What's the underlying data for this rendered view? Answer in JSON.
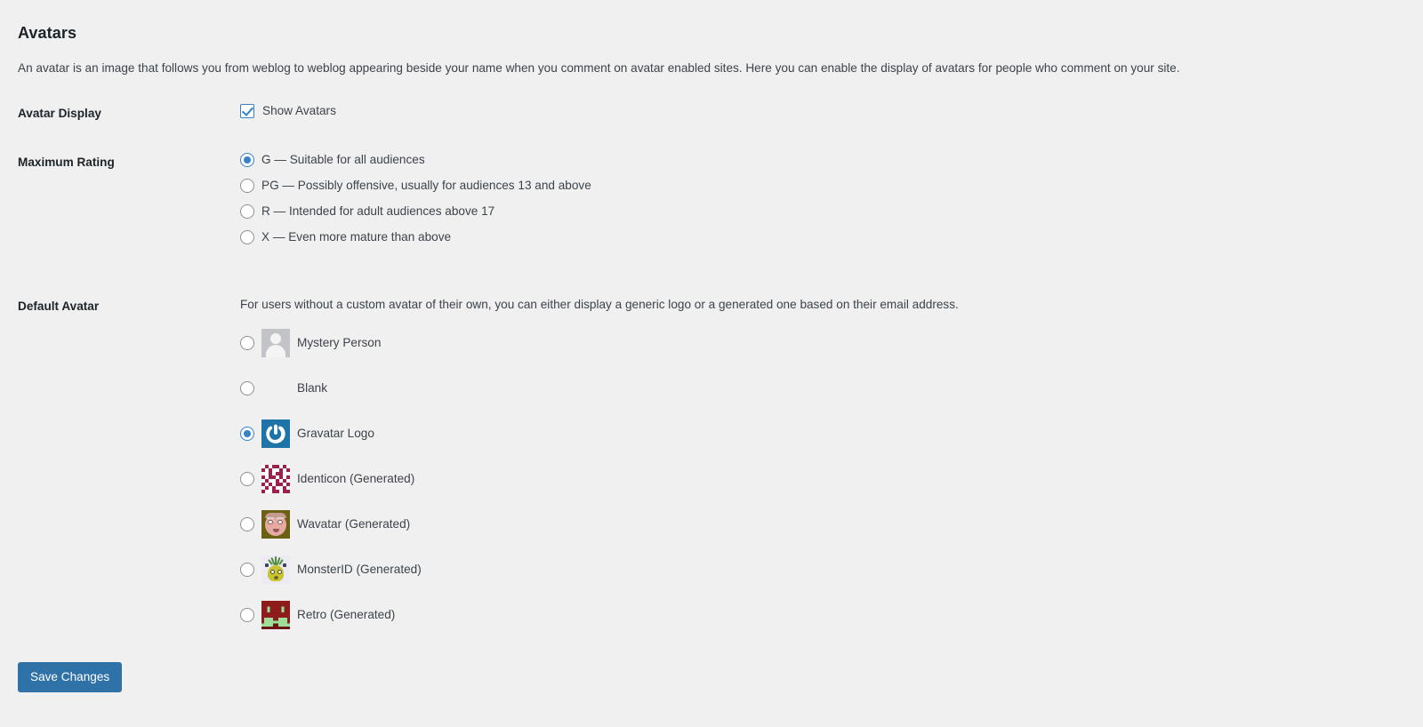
{
  "section": {
    "title": "Avatars",
    "description": "An avatar is an image that follows you from weblog to weblog appearing beside your name when you comment on avatar enabled sites. Here you can enable the display of avatars for people who comment on your site."
  },
  "avatar_display": {
    "label": "Avatar Display",
    "checkbox_label": "Show Avatars",
    "checked": true
  },
  "maximum_rating": {
    "label": "Maximum Rating",
    "selected": "G",
    "options": [
      {
        "value": "G",
        "label": "G — Suitable for all audiences",
        "checked": true
      },
      {
        "value": "PG",
        "label": "PG — Possibly offensive, usually for audiences 13 and above",
        "checked": false
      },
      {
        "value": "R",
        "label": "R — Intended for adult audiences above 17",
        "checked": false
      },
      {
        "value": "X",
        "label": "X — Even more mature than above",
        "checked": false
      }
    ]
  },
  "default_avatar": {
    "label": "Default Avatar",
    "description": "For users without a custom avatar of their own, you can either display a generic logo or a generated one based on their email address.",
    "selected": "gravatar_default",
    "options": [
      {
        "value": "mystery",
        "label": "Mystery Person",
        "icon": "mystery-person-avatar",
        "checked": false
      },
      {
        "value": "blank",
        "label": "Blank",
        "icon": "blank-avatar",
        "checked": false
      },
      {
        "value": "gravatar_default",
        "label": "Gravatar Logo",
        "icon": "gravatar-logo-avatar",
        "checked": true
      },
      {
        "value": "identicon",
        "label": "Identicon (Generated)",
        "icon": "identicon-avatar",
        "checked": false
      },
      {
        "value": "wavatar",
        "label": "Wavatar (Generated)",
        "icon": "wavatar-avatar",
        "checked": false
      },
      {
        "value": "monsterid",
        "label": "MonsterID (Generated)",
        "icon": "monsterid-avatar",
        "checked": false
      },
      {
        "value": "retro",
        "label": "Retro (Generated)",
        "icon": "retro-avatar",
        "checked": false
      }
    ]
  },
  "submit": {
    "save_label": "Save Changes"
  },
  "colors": {
    "page_background": "#f0f0f1",
    "accent": "#3582c4",
    "button_primary": "#2e72a8",
    "heading_text": "#1d2327",
    "body_text": "#3c434a",
    "gravatar_blue": "#1e73a8",
    "identicon_maroon": "#9c1f4c",
    "wavatar_olive": "#6b6114",
    "monsterid_lavender": "#eeeaf4",
    "retro_red": "#8f1c1c",
    "retro_green": "#9bdf9b"
  }
}
